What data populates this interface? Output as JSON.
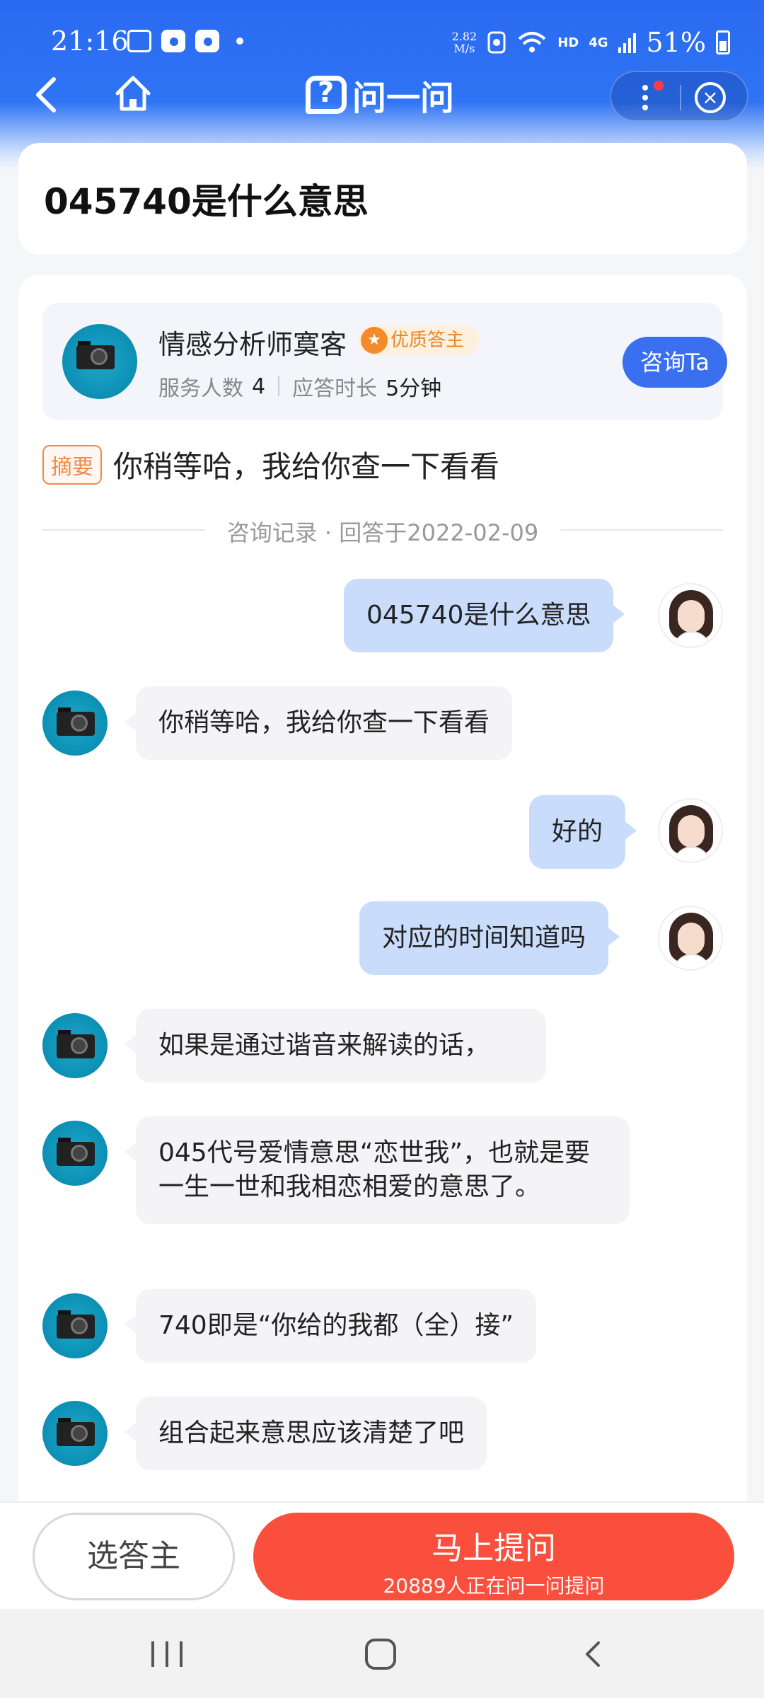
{
  "status_bar": {
    "time": "21:16",
    "net_speed_value": "2.82",
    "net_speed_unit": "M/s",
    "hd": "HD",
    "network": "4G",
    "battery": "51%"
  },
  "nav": {
    "logo_text": "问一问"
  },
  "question": {
    "title": "045740是什么意思"
  },
  "answerer": {
    "name": "情感分析师寞客",
    "badge": "优质答主",
    "served_label": "服务人数",
    "served_value": "4",
    "response_label": "应答时长",
    "response_value": "5分钟",
    "consult_button": "咨询Ta"
  },
  "summary": {
    "tag": "摘要",
    "text": "你稍等哈，我给你查一下看看"
  },
  "record_divider": "咨询记录 · 回答于2022-02-09",
  "messages": [
    {
      "from": "user",
      "text": "045740是什么意思"
    },
    {
      "from": "expert",
      "text": "你稍等哈，我给你查一下看看"
    },
    {
      "from": "user",
      "text": "好的"
    },
    {
      "from": "user",
      "text": "对应的时间知道吗"
    },
    {
      "from": "expert",
      "text": "如果是通过谐音来解读的话，"
    },
    {
      "from": "expert",
      "text": "045代号爱情意思“恋世我”，也就是要一生一世和我相恋相爱的意思了。"
    },
    {
      "from": "expert",
      "text": "740即是“你给的我都（全）接”"
    },
    {
      "from": "expert",
      "text": "组合起来意思应该清楚了吧"
    }
  ],
  "bottom_bar": {
    "pick_button": "选答主",
    "ask_button": "马上提问",
    "ask_sub": "20889人正在问一问提问"
  },
  "colors": {
    "brand_blue": "#2a6af1",
    "consult_blue": "#3a6ff0",
    "ask_red": "#fb4f3e",
    "user_bubble": "#c9dcfb",
    "badge_orange": "#e7872b"
  }
}
